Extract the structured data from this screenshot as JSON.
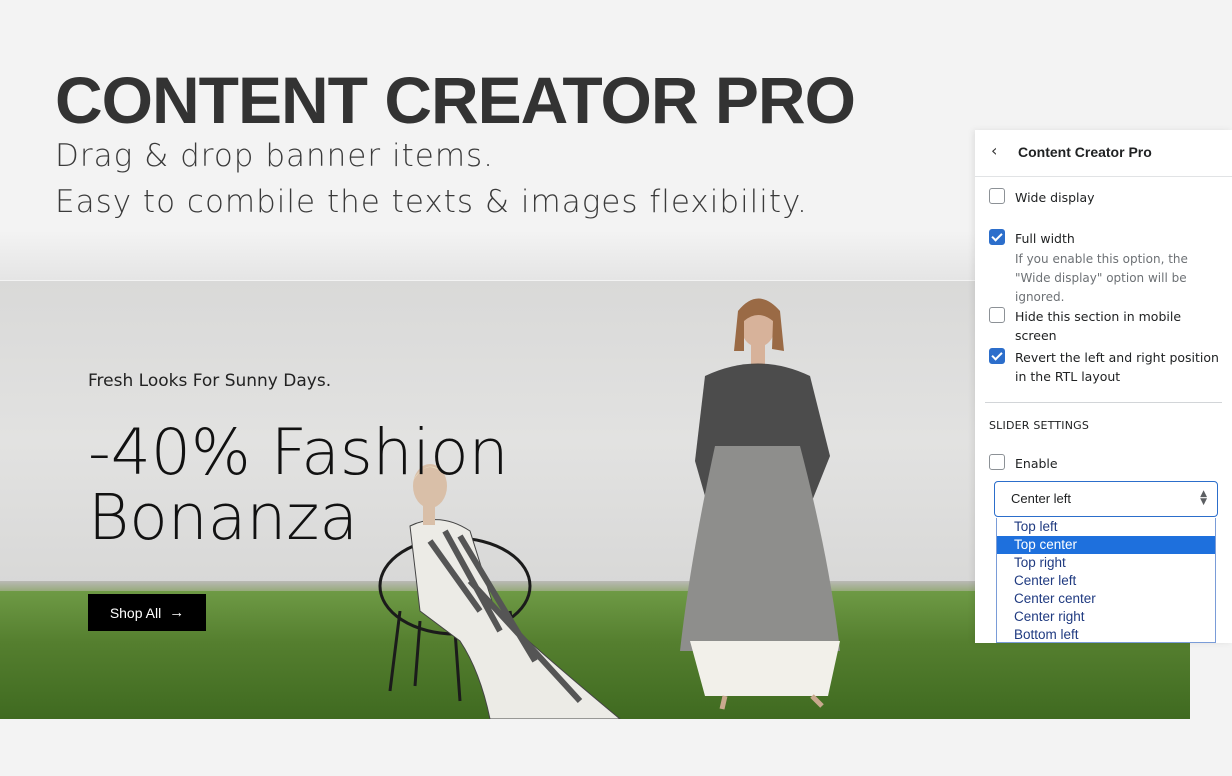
{
  "hero": {
    "title": "CONTENT CREATOR PRO",
    "line1": "Drag & drop banner items.",
    "line2": "Easy to combile the texts & images flexibility."
  },
  "banner": {
    "kicker": "Fresh Looks For Sunny Days.",
    "headline_1": "-40% Fashion",
    "headline_2": "Bonanza",
    "cta_label": "Shop All",
    "cta_icon": "arrow-right-icon"
  },
  "panel": {
    "title": "Content Creator Pro",
    "back_icon": "chevron-left-icon",
    "options": [
      {
        "label": "Wide display",
        "checked": false
      },
      {
        "label": "Full width",
        "checked": true,
        "help": "If you enable this option, the \"Wide display\" option will be ignored."
      },
      {
        "label": "Hide this section in mobile screen",
        "checked": false
      },
      {
        "label": "Revert the left and right position in the RTL layout",
        "checked": true
      }
    ],
    "slider_section": "SLIDER SETTINGS",
    "enable_label": "Enable",
    "enable_checked": false,
    "select_value": "Center left",
    "dropdown_options": [
      "Top left",
      "Top center",
      "Top right",
      "Center left",
      "Center center",
      "Center right",
      "Bottom left"
    ],
    "highlighted_option": "Top center"
  },
  "colors": {
    "accent": "#2c6ecb",
    "highlight": "#1e70dd",
    "button_bg": "#000000"
  }
}
